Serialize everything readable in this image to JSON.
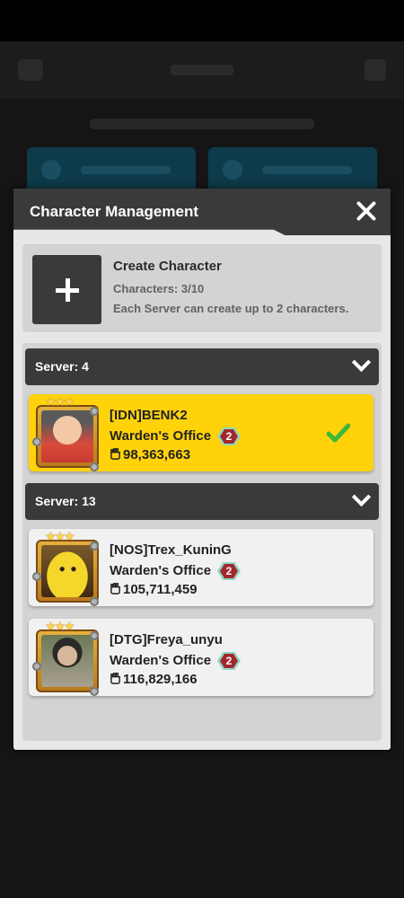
{
  "modal": {
    "title": "Character Management"
  },
  "create": {
    "title": "Create Character",
    "count_text": "Characters: 3/10",
    "note": "Each Server can create up to 2 characters."
  },
  "servers": [
    {
      "label": "Server: 4",
      "characters": [
        {
          "name": "[IDN]BENK2",
          "office": "Warden's Office",
          "rank": "2",
          "power": "98,363,663",
          "selected": true
        }
      ]
    },
    {
      "label": "Server: 13",
      "characters": [
        {
          "name": "[NOS]Trex_KuninG",
          "office": "Warden's Office",
          "rank": "2",
          "power": "105,711,459",
          "selected": false
        },
        {
          "name": "[DTG]Freya_unyu",
          "office": "Warden's Office",
          "rank": "2",
          "power": "116,829,166",
          "selected": false
        }
      ]
    }
  ],
  "colors": {
    "selected_card": "#ffd20a",
    "header_dark": "#3a3a3a",
    "check_green": "#3cb83c"
  },
  "icons": [
    "close-icon",
    "plus-icon",
    "chevron-down-icon",
    "fist-icon",
    "check-icon"
  ]
}
